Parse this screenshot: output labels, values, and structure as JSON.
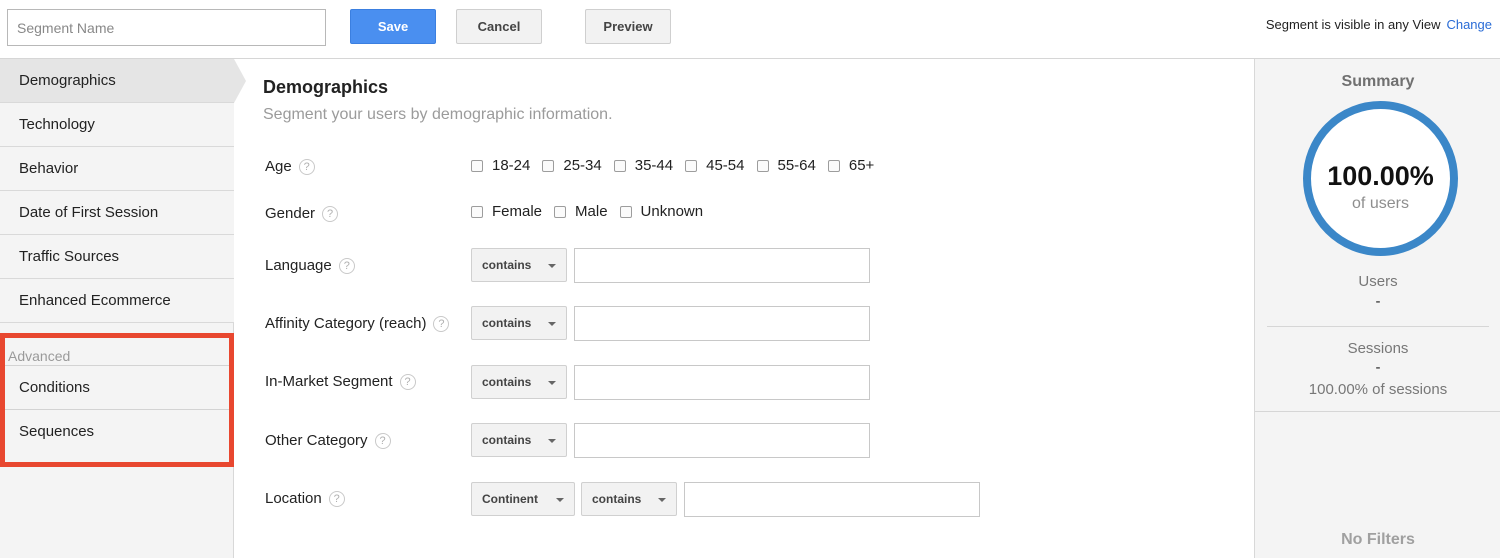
{
  "topbar": {
    "segment_name_placeholder": "Segment Name",
    "save_label": "Save",
    "cancel_label": "Cancel",
    "preview_label": "Preview",
    "visibility_text": "Segment is visible in any View",
    "change_label": "Change"
  },
  "sidebar": {
    "items": [
      {
        "label": "Demographics",
        "active": true
      },
      {
        "label": "Technology"
      },
      {
        "label": "Behavior"
      },
      {
        "label": "Date of First Session"
      },
      {
        "label": "Traffic Sources"
      },
      {
        "label": "Enhanced Ecommerce"
      }
    ],
    "advanced": {
      "label": "Advanced",
      "items": [
        {
          "label": "Conditions"
        },
        {
          "label": "Sequences"
        }
      ]
    },
    "highlight_color": "#e8472f"
  },
  "main": {
    "title": "Demographics",
    "subtitle": "Segment your users by demographic information.",
    "help_glyph": "?",
    "age": {
      "label": "Age",
      "options": [
        "18-24",
        "25-34",
        "35-44",
        "45-54",
        "55-64",
        "65+"
      ]
    },
    "gender": {
      "label": "Gender",
      "options": [
        "Female",
        "Male",
        "Unknown"
      ]
    },
    "language": {
      "label": "Language",
      "operator": "contains",
      "value": ""
    },
    "affinity": {
      "label": "Affinity Category (reach)",
      "operator": "contains",
      "value": ""
    },
    "in_market": {
      "label": "In-Market Segment",
      "operator": "contains",
      "value": ""
    },
    "other": {
      "label": "Other Category",
      "operator": "contains",
      "value": ""
    },
    "location": {
      "label": "Location",
      "scope": "Continent",
      "operator": "contains",
      "value": ""
    }
  },
  "summary": {
    "title": "Summary",
    "percent": "100.00%",
    "percent_label": "of users",
    "users_label": "Users",
    "users_value": "-",
    "sessions_label": "Sessions",
    "sessions_value": "-",
    "sessions_pct": "100.00% of sessions",
    "no_filters": "No Filters",
    "ring_color": "#3b87c8"
  },
  "colors": {
    "save_button": "#4a8ff0",
    "link": "#2a6cd6"
  }
}
